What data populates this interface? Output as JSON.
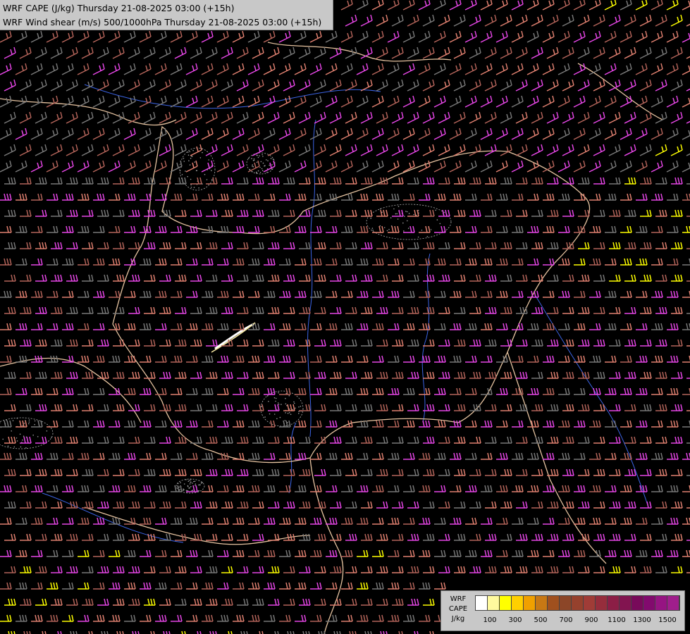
{
  "header": {
    "cape_title": "WRF CAPE (J/kg) Thursday 21-08-2025 03:00 (+15h)",
    "shear_title": "WRF Wind shear (m/s) 500/1000hPa Thursday 21-08-2025 03:00 (+15h)"
  },
  "legend": {
    "label_line_1": "WRF",
    "label_line_2": "CAPE",
    "label_line_3": "J/kg",
    "swatch_colors": [
      "#ffffff",
      "#fffa9e",
      "#ffff00",
      "#ffd000",
      "#f0a000",
      "#c87814",
      "#a0501e",
      "#8c4628",
      "#96412d",
      "#a03c37",
      "#962d3c",
      "#8c1e46",
      "#821450",
      "#780a5a",
      "#820a6e",
      "#961482",
      "#a01e8c"
    ],
    "tick_labels": [
      "100",
      "300",
      "500",
      "700",
      "900",
      "1100",
      "1300",
      "1500"
    ]
  },
  "colors": {
    "background": "#000000",
    "border_line": "#e6c3a0",
    "river_line": "#3c64e6",
    "barb_low": "#787878",
    "barb_mid_low": "#b4645a",
    "barb_mid": "#e08070",
    "barb_high": "#e646e6",
    "barb_extreme": "#ffff00"
  }
}
